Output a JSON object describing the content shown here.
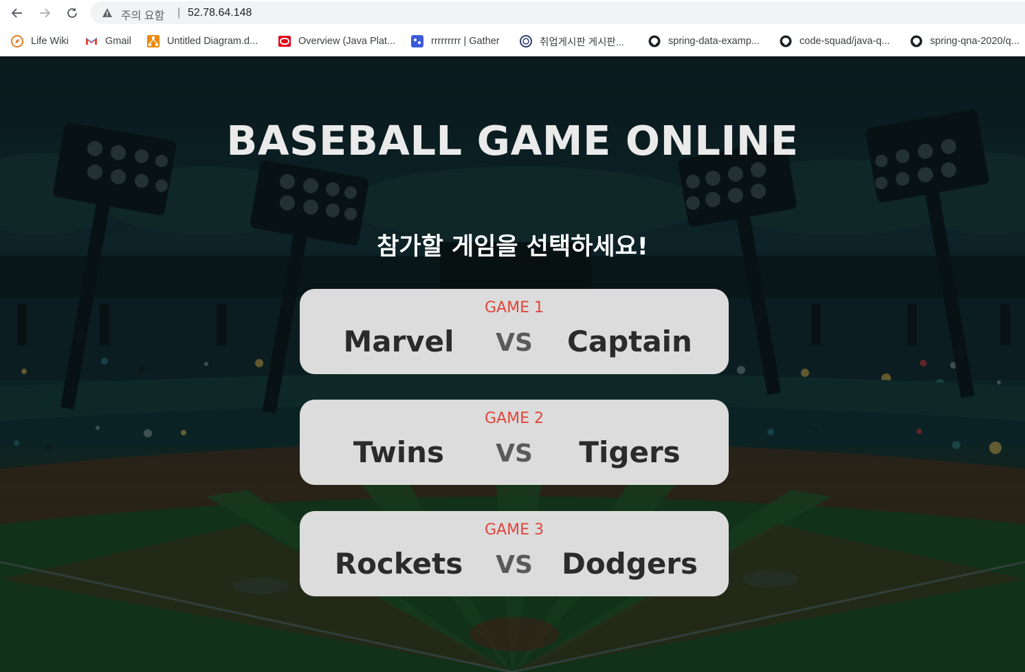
{
  "browser": {
    "security_label": "주의 요함",
    "separator": "|",
    "url": "52.78.64.148"
  },
  "bookmarks": [
    {
      "label": "Life Wiki",
      "icon": "compass-icon"
    },
    {
      "label": "Gmail",
      "icon": "gmail-icon"
    },
    {
      "label": "Untitled Diagram.d...",
      "icon": "diagram-icon"
    },
    {
      "label": "Overview (Java Plat...",
      "icon": "oracle-icon"
    },
    {
      "label": "rrrrrrrrr | Gather",
      "icon": "gather-icon"
    },
    {
      "label": "취업게시판 게시판...",
      "icon": "board-icon"
    },
    {
      "label": "spring-data-examp...",
      "icon": "github-icon"
    },
    {
      "label": "code-squad/java-q...",
      "icon": "github-icon"
    },
    {
      "label": "spring-qna-2020/q...",
      "icon": "github-icon"
    }
  ],
  "page": {
    "title": "BASEBALL GAME ONLINE",
    "subtitle": "참가할 게임을 선택하세요!",
    "vs_label": "VS"
  },
  "games": [
    {
      "label": "GAME 1",
      "home": "Marvel",
      "away": "Captain"
    },
    {
      "label": "GAME 2",
      "home": "Twins",
      "away": "Tigers"
    },
    {
      "label": "GAME 3",
      "home": "Rockets",
      "away": "Dodgers"
    }
  ],
  "colors": {
    "game_label": "#e0453b",
    "card_bg": "#dcdcdc",
    "team_text": "#2b2b2b"
  }
}
